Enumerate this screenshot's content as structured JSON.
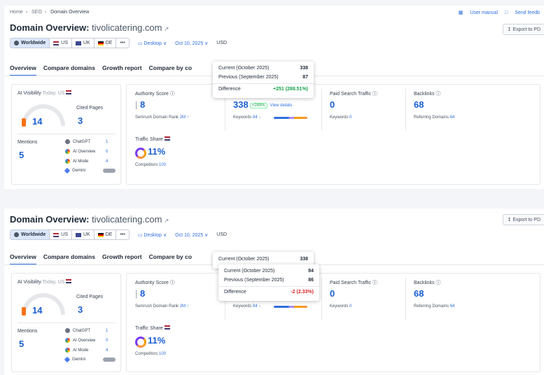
{
  "breadcrumb": [
    "Home",
    "SEO",
    "Domain Overview"
  ],
  "top_links": {
    "user_manual": "User manual",
    "send_feedback": "Send feedb"
  },
  "title": {
    "prefix": "Domain Overview:",
    "domain": "tivolicatering.com"
  },
  "export_label": "Export to PD",
  "db_options": [
    {
      "label": "Worldwide",
      "selected": true
    },
    {
      "label": "US"
    },
    {
      "label": "UK"
    },
    {
      "label": "DE"
    },
    {
      "label": "•••"
    }
  ],
  "device": "Desktop ∨",
  "date": "Oct 10, 2025 ∨",
  "currency": "USD",
  "tabs": [
    "Overview",
    "Compare domains",
    "Growth report",
    "Compare by co"
  ],
  "ai_visibility": {
    "label": "AI Visibility",
    "region": "Today, US",
    "score": "14",
    "cited_pages_label": "Cited Pages",
    "cited_pages": "3",
    "mentions_label": "Mentions",
    "mentions": "5",
    "sources": [
      {
        "name": "ChatGPT",
        "value": "1"
      },
      {
        "name": "AI Overview",
        "value": "0"
      },
      {
        "name": "AI Mode",
        "value": "4"
      },
      {
        "name": "Gemini",
        "value": ""
      }
    ]
  },
  "authority": {
    "label": "Authority Score",
    "value": "8",
    "rank_label": "Semrush Domain Rank",
    "rank_value": "2M ↑"
  },
  "traffic_share": {
    "label": "Traffic Share",
    "value": "11%",
    "competitors_label": "Competitors",
    "competitors_value": "100"
  },
  "organic": {
    "value": "338",
    "badge": "+289%",
    "view_details": "View details",
    "keywords_label": "Keywords",
    "keywords_value": "84 ↓"
  },
  "paid": {
    "label": "Paid Search Traffic",
    "value": "0",
    "keywords_label": "Keywords",
    "keywords_value": "0"
  },
  "backlinks": {
    "label": "Backlinks",
    "value": "68",
    "ref_label": "Referring Domains",
    "ref_value": "64"
  },
  "tooltip1": {
    "current_label": "Current (October 2025)",
    "current_value": "338",
    "previous_label": "Previous (September 2025)",
    "previous_value": "87",
    "difference_label": "Difference",
    "difference_value": "+251 (288.51%)"
  },
  "tooltip2": {
    "current_label": "Current (October 2025)",
    "current_value": "338",
    "kw_current_label": "Current (October 2025)",
    "kw_current_value": "84",
    "kw_previous_label": "Previous (September 2025)",
    "kw_previous_value": "86",
    "kw_difference_label": "Difference",
    "kw_difference_value": "-2 (2.33%)"
  },
  "colors": {
    "accent": "#1a5fd1",
    "positive": "#16a34a",
    "negative": "#dc2626",
    "gauge": "#f97316"
  }
}
